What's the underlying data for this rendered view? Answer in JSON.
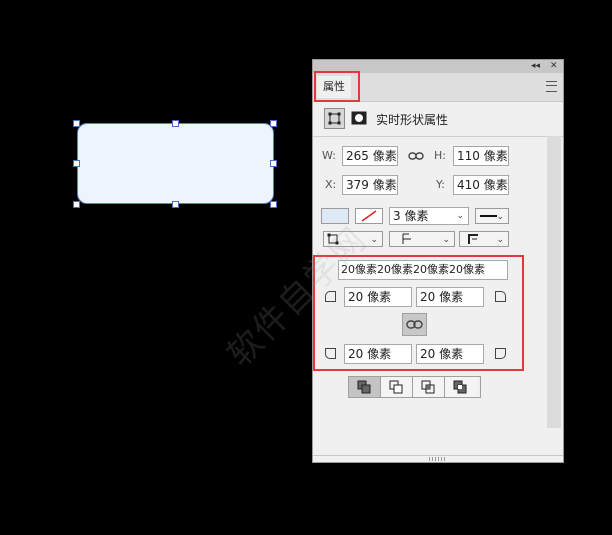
{
  "panel": {
    "collapse_glyph": "◂◂",
    "close_glyph": "✕",
    "tab_label": "属性",
    "section_title": "实时形状属性",
    "w_label": "W:",
    "w_value": "265 像素",
    "h_label": "H:",
    "h_value": "110 像素",
    "x_label": "X:",
    "x_value": "379 像素",
    "y_label": "Y:",
    "y_value": "410 像素",
    "stroke_width": "3 像素",
    "radius_all": "20像素20像素20像素20像素",
    "radius_tl": "20 像素",
    "radius_tr": "20 像素",
    "radius_bl": "20 像素",
    "radius_br": "20 像素"
  },
  "colors": {
    "accent_red": "#e0393e",
    "shape_fill": "#eef4fc",
    "shape_stroke": "#5c7fc8"
  },
  "watermark": "软件自学网"
}
